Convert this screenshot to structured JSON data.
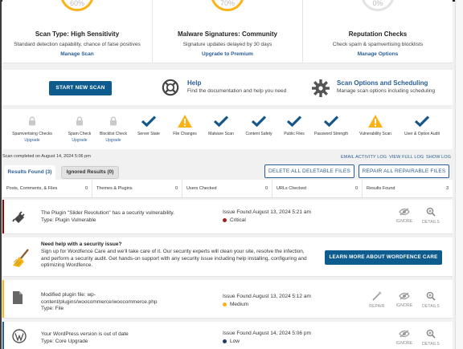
{
  "cards": [
    {
      "gauge": "60%",
      "title": "Scan Type: High Sensitivity",
      "desc": "Standard detection capability, chance of false positives",
      "link": "Manage Scan"
    },
    {
      "gauge": "70%",
      "title": "Malware Signatures: Community",
      "desc": "Signature updates delayed by 30 days",
      "link": "Upgrade to Premium"
    },
    {
      "gauge": "0%",
      "title": "Reputation Checks",
      "desc": "Check spam & spamvertising blocklists",
      "link": "Manage Options"
    }
  ],
  "actions": {
    "start_scan": "START NEW SCAN",
    "help_title": "Help",
    "help_desc": "Find the documentation and help you need",
    "options_title": "Scan Options and Scheduling",
    "options_desc": "Manage scan options including scheduling"
  },
  "stages": [
    {
      "name": "Spamvertising Checks",
      "status": "locked",
      "upgrade": "Upgrade"
    },
    {
      "name": "Spam Check",
      "status": "locked",
      "upgrade": "Upgrade"
    },
    {
      "name": "Blocklist Check",
      "status": "locked",
      "upgrade": "Upgrade"
    },
    {
      "name": "Server State",
      "status": "ok"
    },
    {
      "name": "File Changes",
      "status": "warning"
    },
    {
      "name": "Malware Scan",
      "status": "ok"
    },
    {
      "name": "Content Safety",
      "status": "ok"
    },
    {
      "name": "Public Files",
      "status": "ok"
    },
    {
      "name": "Password Strength",
      "status": "ok"
    },
    {
      "name": "Vulnerability Scan",
      "status": "warning"
    },
    {
      "name": "User & Option Audit",
      "status": "ok"
    }
  ],
  "scan_completed": "Scan completed on August 14, 2024 5:06 pm",
  "log_links": {
    "email": "EMAIL ACTIVITY LOG",
    "full": "VIEW FULL LOG",
    "show": "SHOW LOG"
  },
  "tabs": {
    "found": "Results Found (3)",
    "ignored": "Ignored Results (0)"
  },
  "bulk": {
    "delete": "DELETE ALL DELETABLE FILES",
    "repair": "REPAIR ALL REPAIRABLE FILES"
  },
  "summary": [
    {
      "label": "Posts, Comments, & Files",
      "value": "0"
    },
    {
      "label": "Themes & Plugins",
      "value": "0"
    },
    {
      "label": "Users Checked",
      "value": "0"
    },
    {
      "label": "URLs Checked",
      "value": "0"
    },
    {
      "label": "Results Found",
      "value": "3"
    }
  ],
  "issues": [
    {
      "title": "The Plugin \"Slider Revolution\" has a security vulnerability.",
      "type": "Type: Plugin Vulnerable",
      "found": "Issue Found August 13, 2024 5:21 am",
      "severity": "Critical",
      "sev_color": "#a0221d",
      "stripe": "#930000"
    },
    {
      "title_line1": "Modified plugin file: wp-",
      "title_line2": "content/plugins/woocommerce/woocommerce.php",
      "type": "Type: File",
      "found": "Issue Found August 13, 2024 5:12 am",
      "severity": "Medium",
      "sev_color": "#fcb214",
      "stripe": "#fcb214"
    },
    {
      "title": "Your WordPress version is out of date",
      "type": "Type: Core Upgrade",
      "found": "Issue Found August 14, 2024 5:06 pm",
      "severity": "Low",
      "sev_color": "#1c3d6f",
      "stripe": "#2a5d95"
    }
  ],
  "issue_actions": {
    "repair": "REPAIR",
    "ignore": "IGNORE",
    "details": "DETAILS"
  },
  "promo": {
    "title": "Need help with a security issue?",
    "text": "Sign up for Wordfence Care and we'll take care of it. Our security experts will clean your site, resolve the infection, and perform a security audit. Get hands-on support with any security issue including help installing, configuring and optimizing Wordfence.",
    "cta": "LEARN MORE ABOUT WORDFENCE CARE"
  }
}
